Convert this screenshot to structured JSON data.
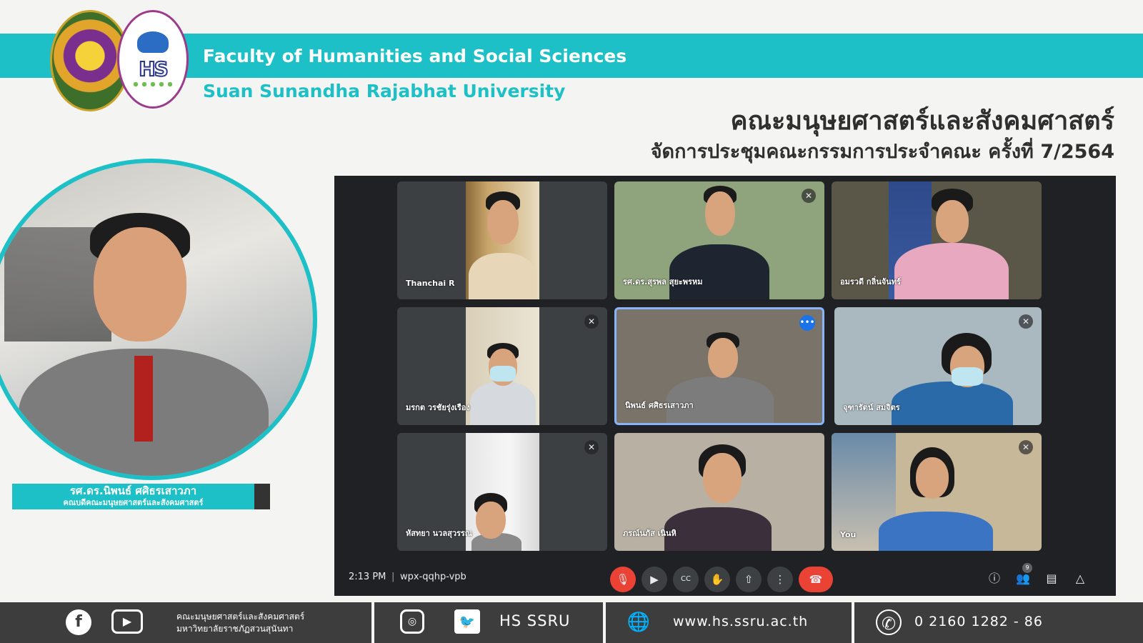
{
  "header": {
    "title_en": "Faculty of Humanities and Social Sciences",
    "subtitle_en": "Suan Sunandha Rajabhat University",
    "title_th": "คณะมนุษยศาสตร์และสังคมศาสตร์",
    "subtitle_th": "จัดการประชุมคณะกรรมการประจำคณะ ครั้งที่ 7/2564",
    "logo_fac_mark": "HS"
  },
  "presenter": {
    "name": "รศ.ดร.นิพนธ์ ศศิธรเสาวภา",
    "role": "คณบดีคณะมนุษยศาสตร์และสังคมศาสตร์"
  },
  "meet": {
    "tiles": [
      {
        "name": "Thanchai R"
      },
      {
        "name": "รศ.ดร.สุรพล สุยะพรหม"
      },
      {
        "name": "อมรวดี กลิ่นจันทร์"
      },
      {
        "name": "มรกต วรชัยรุ่งเรือง"
      },
      {
        "name": "นิพนธ์ ศศิธรเสาวภา"
      },
      {
        "name": "จุฑารัตน์ สมจิตร"
      },
      {
        "name": "หัสทยา นวลสุวรรณ"
      },
      {
        "name": "ภรณ์นภัส เนินหิ"
      },
      {
        "name": "You"
      }
    ],
    "time": "2:13 PM",
    "separator": "|",
    "meeting_code": "wpx-qqhp-vpb",
    "participants_count": "9"
  },
  "footer": {
    "th_line1": "คณะมนุษยศาสตร์และสังคมศาสตร์",
    "th_line2": "มหาวิทยาลัยราชภัฏสวนสุนันทา",
    "social": "HS SSRU",
    "website": "www.hs.ssru.ac.th",
    "phone": "0  2160 1282 - 86"
  },
  "colors": {
    "accent": "#1cc0c6",
    "footer_bg": "#3d3d3d",
    "meet_bg": "#202124",
    "hangup": "#ea4335"
  }
}
